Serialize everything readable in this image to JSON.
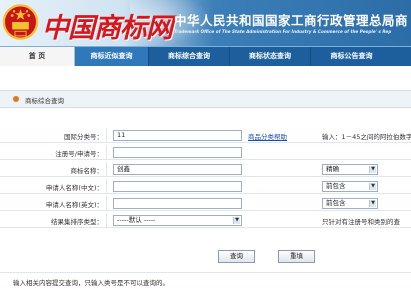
{
  "header": {
    "logo_text": "中国商标网",
    "title": "中华人民共和国国家工商行政管理总局商",
    "subtitle": "Trademark Office of The State Administration For Industry & Commerce of the People' s Rep"
  },
  "nav": {
    "items": [
      "首 页",
      "商标近似查询",
      "商标综合查询",
      "商标状态查询",
      "商标公告查询"
    ]
  },
  "section_title": "商标综合查询",
  "form": {
    "class_no": {
      "label": "国际分类号：",
      "value": "11",
      "help_link": "商品分类帮助",
      "hint": "输入：1－45之间的阿拉伯数字"
    },
    "reg_no": {
      "label": "注册号/申请号：",
      "value": ""
    },
    "tm_name": {
      "label": "商标名称：",
      "value": "创鑫",
      "match": "精确"
    },
    "applicant_cn": {
      "label": "申请人名称(中文)：",
      "value": "",
      "match": "前包含"
    },
    "applicant_en": {
      "label": "申请人名称(英文)：",
      "value": "",
      "match": "前包含"
    },
    "sort": {
      "label": "结果集排序类型：",
      "value": "-----默认 -----",
      "hint": "只针对有注册号和类别的查"
    }
  },
  "buttons": {
    "query": "查询",
    "reset": "重填"
  },
  "footer_note": "输入相关内容提交查询，只输入类号是不可以查询的。",
  "colors": {
    "nav": "#1c5f9c",
    "nav_active": "#2f79ba",
    "logo_red": "#d8161b",
    "link": "#1a49b0"
  }
}
